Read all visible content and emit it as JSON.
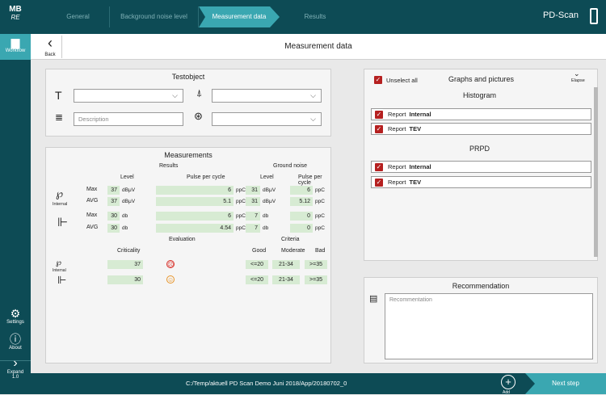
{
  "app": {
    "logo_line1": "MB",
    "logo_line2": "RE",
    "name": "PD-Scan"
  },
  "steps": [
    "General",
    "Background noise level",
    "Measurement data",
    "Results"
  ],
  "active_step": "Measurement data",
  "sidebar": {
    "workflow": "Workflow",
    "settings": "Settings",
    "about": "About",
    "expand": "Expand",
    "version": "1.0"
  },
  "header": {
    "back": "Back",
    "title": "Measurement data"
  },
  "testobject": {
    "title": "Testobject",
    "type_value": "",
    "location_value": "",
    "description_placeholder": "Description",
    "phase_value": ""
  },
  "measurements": {
    "title": "Measurements",
    "results_header": "Results",
    "noise_header": "Ground noise",
    "col_level": "Level",
    "col_ppc": "Pulse per cycle",
    "internal_label": "Internal",
    "rows": [
      {
        "sensor": "internal",
        "label": "Max",
        "level": "37",
        "level_unit": "dBμV",
        "ppc": "6",
        "ppc_unit": "ppC",
        "noise_level": "31",
        "noise_level_unit": "dBμV",
        "noise_ppc": "6",
        "noise_ppc_unit": "ppC"
      },
      {
        "sensor": "internal",
        "label": "AVG",
        "level": "37",
        "level_unit": "dBμV",
        "ppc": "5.1",
        "ppc_unit": "ppC",
        "noise_level": "31",
        "noise_level_unit": "dBμV",
        "noise_ppc": "5.12",
        "noise_ppc_unit": "ppC"
      },
      {
        "sensor": "tev",
        "label": "Max",
        "level": "30",
        "level_unit": "db",
        "ppc": "6",
        "ppc_unit": "ppC",
        "noise_level": "7",
        "noise_level_unit": "db",
        "noise_ppc": "0",
        "noise_ppc_unit": "ppC"
      },
      {
        "sensor": "tev",
        "label": "AVG",
        "level": "30",
        "level_unit": "db",
        "ppc": "4.54",
        "ppc_unit": "ppC",
        "noise_level": "7",
        "noise_level_unit": "db",
        "noise_ppc": "0",
        "noise_ppc_unit": "ppC"
      }
    ],
    "criticality_header": "Criticality",
    "evaluation_header": "Evaluation",
    "criteria_header": "Criteria",
    "criteria_cols": [
      "Good",
      "Moderate",
      "Bad"
    ],
    "eval_rows": [
      {
        "criticality": "37",
        "status": "bad",
        "status_color": "#d8312a",
        "good": "<=20",
        "moderate": "21-34",
        "bad": ">=35"
      },
      {
        "criticality": "30",
        "status": "moderate",
        "status_color": "#e7952a",
        "good": "<=20",
        "moderate": "21-34",
        "bad": ">=35"
      }
    ]
  },
  "graphs": {
    "unselect_all": "Unselect all",
    "title": "Graphs and pictures",
    "elapse": "Elapse",
    "histogram_title": "Histogram",
    "prpd_title": "PRPD",
    "histogram": [
      {
        "prefix": "Report",
        "name": "Internal",
        "checked": true
      },
      {
        "prefix": "Report",
        "name": "TEV",
        "checked": true
      }
    ],
    "prpd": [
      {
        "prefix": "Report",
        "name": "Internal",
        "checked": true
      },
      {
        "prefix": "Report",
        "name": "TEV",
        "checked": true
      }
    ]
  },
  "recommendation": {
    "title": "Recommendation",
    "placeholder": "Recommentation"
  },
  "footer": {
    "path": "C:/Temp/aktuell PD Scan Demo Juni 2018/App/20180702_0",
    "add": "Add",
    "next": "Next step"
  },
  "colors": {
    "dark": "#0d4b55",
    "accent": "#3aa7b1",
    "value_bg": "#d7ebd3",
    "check": "#b52020"
  }
}
